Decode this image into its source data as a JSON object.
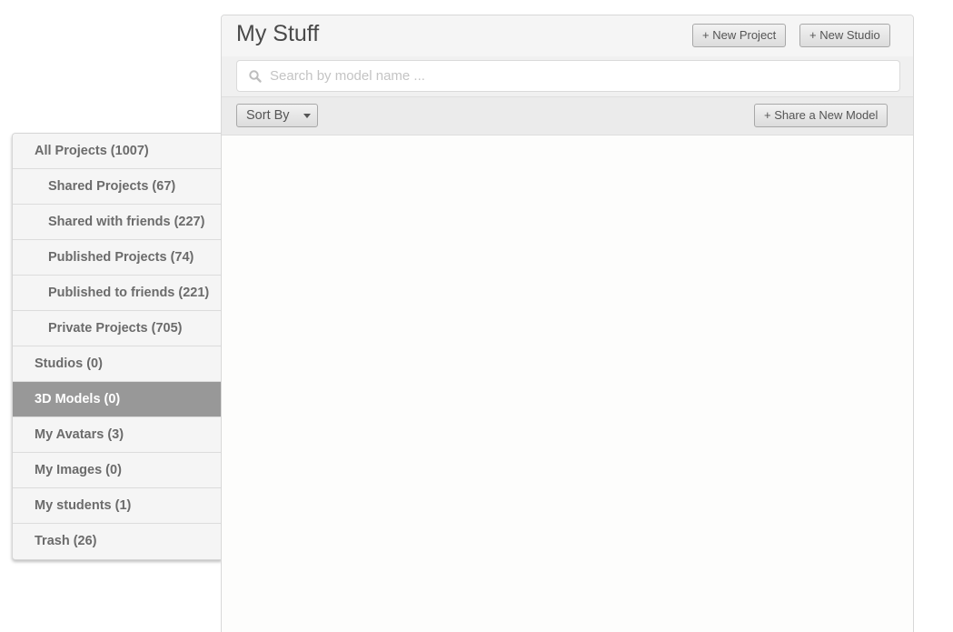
{
  "header": {
    "title": "My Stuff",
    "new_project_label": "+ New Project",
    "new_studio_label": "+ New Studio"
  },
  "search": {
    "placeholder": "Search by model name ...",
    "value": ""
  },
  "toolbar": {
    "sort_label": "Sort By",
    "share_label": "+ Share a New Model"
  },
  "sidebar": {
    "items": [
      {
        "label": "All Projects (1007)"
      },
      {
        "label": "Shared Projects (67)"
      },
      {
        "label": "Shared with friends (227)"
      },
      {
        "label": "Published Projects (74)"
      },
      {
        "label": "Published to friends (221)"
      },
      {
        "label": "Private Projects (705)"
      },
      {
        "label": "Studios (0)"
      },
      {
        "label": "3D Models (0)"
      },
      {
        "label": "My Avatars (3)"
      },
      {
        "label": "My Images (0)"
      },
      {
        "label": "My students (1)"
      },
      {
        "label": "Trash (26)"
      }
    ],
    "active_item": "3D Models (0)"
  },
  "colors": {
    "active_item_bg": "#989898",
    "sidebar_bg": "#f5f5f5",
    "title_text": "#4a4a4a"
  }
}
